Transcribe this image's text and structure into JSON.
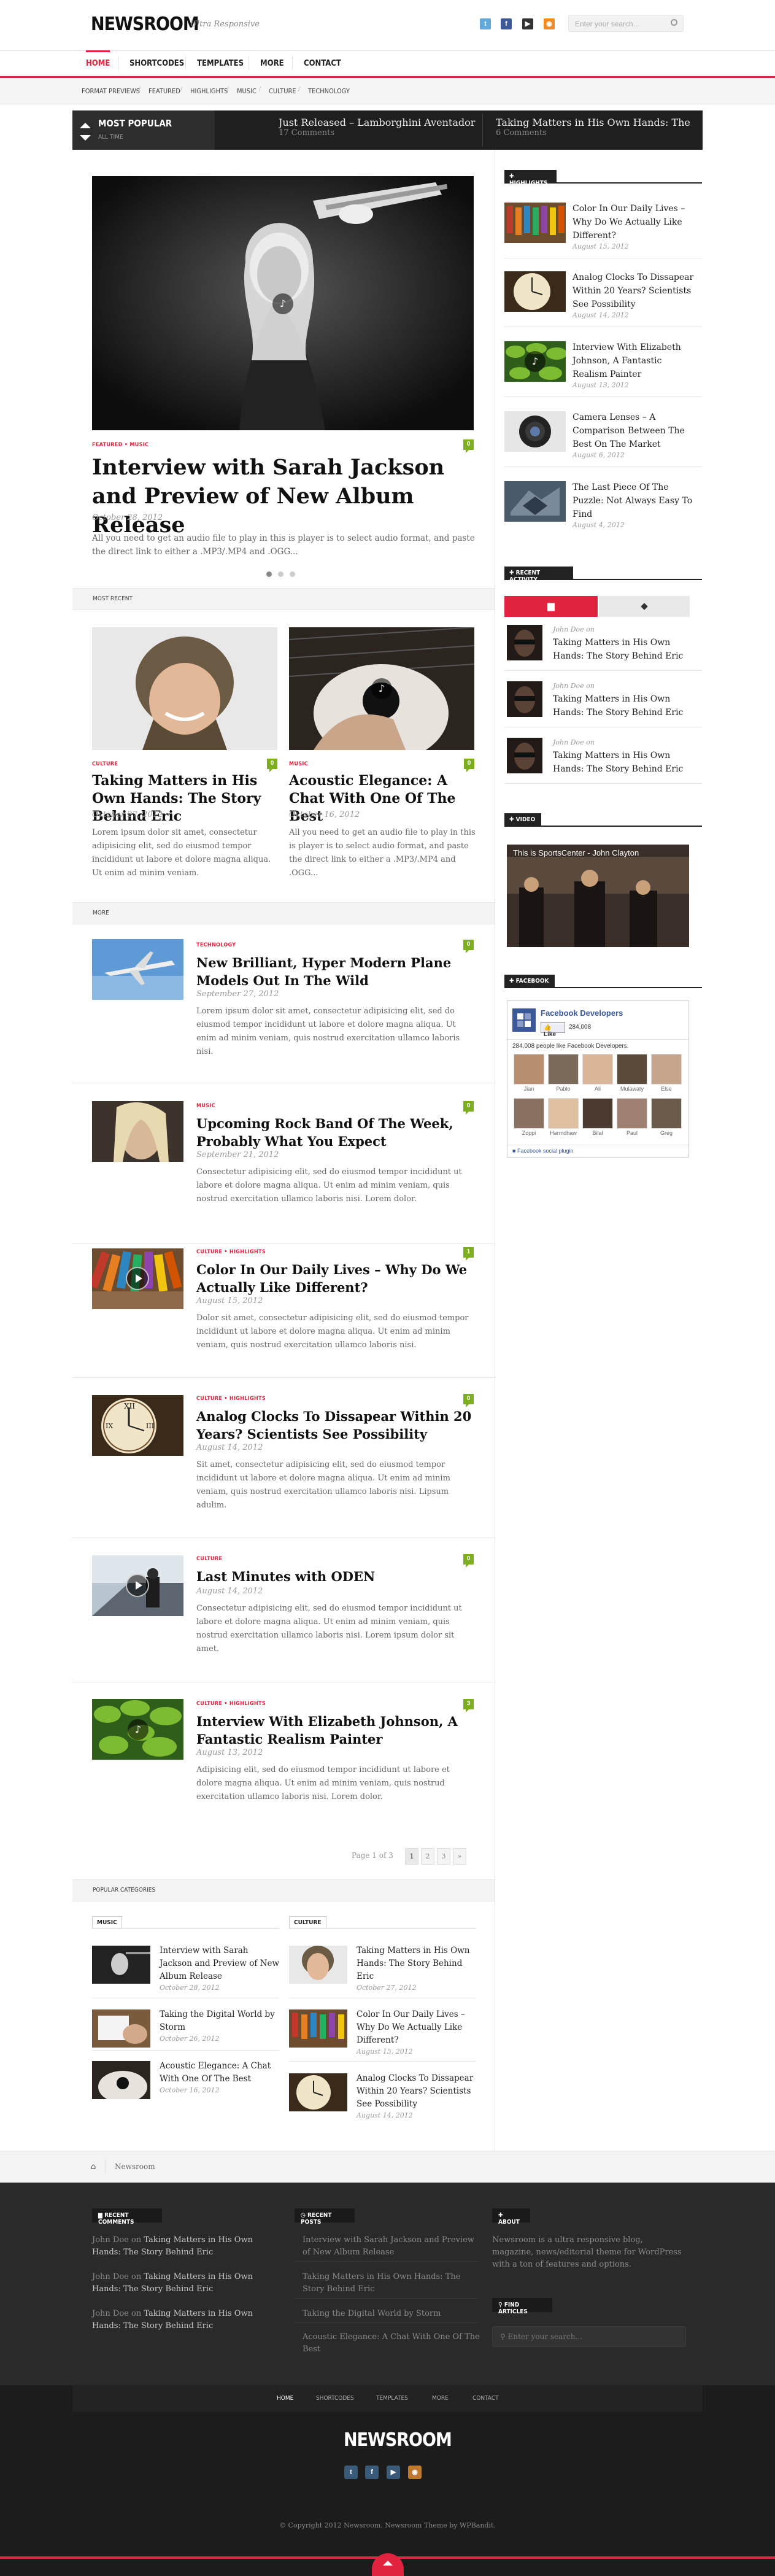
{
  "site": {
    "logo": "NEWSROOM",
    "tagline": "Ultra Responsive",
    "search_placeholder": "Enter your search..."
  },
  "nav": {
    "items": [
      "HOME",
      "SHORTCODES",
      "TEMPLATES",
      "MORE",
      "CONTACT"
    ]
  },
  "subnav": {
    "items": [
      "FORMAT PREVIEWS",
      "FEATURED",
      "HIGHLIGHTS",
      "MUSIC",
      "CULTURE",
      "TECHNOLOGY"
    ]
  },
  "popular_bar": {
    "title": "MOST POPULAR",
    "sub": "ALL TIME",
    "items": [
      {
        "title": "Just Released – Lamborghini Aventador",
        "meta": "17 Comments"
      },
      {
        "title": "Taking Matters in His Own Hands: The",
        "meta": "6 Comments"
      }
    ]
  },
  "featured": {
    "category": "FEATURED • MUSIC",
    "comments": "0",
    "title": "Interview with Sarah Jackson and Preview of New Album Release",
    "date": "October 28, 2012",
    "excerpt": "All you need to get an audio file to play in this is player is to select audio format, and paste the direct link to either a .MP3/.MP4 and .OGG..."
  },
  "most_recent": {
    "label": "MOST RECENT",
    "posts": [
      {
        "category": "CULTURE",
        "comments": "0",
        "title": "Taking Matters in His Own Hands: The Story Behind Eric",
        "date": "October 27, 2012",
        "excerpt": "Lorem ipsum dolor sit amet, consectetur adipisicing elit, sed do eiusmod tempor incididunt ut labore et dolore magna aliqua. Ut enim ad minim veniam."
      },
      {
        "category": "MUSIC",
        "comments": "0",
        "title": "Acoustic Elegance: A Chat With One Of The Best",
        "date": "October 16, 2012",
        "excerpt": "All you need to get an audio file to play in this is player is to select audio format, and paste the direct link to either a .MP3/.MP4 and .OGG..."
      }
    ]
  },
  "more": {
    "label": "MORE",
    "posts": [
      {
        "category": "TECHNOLOGY",
        "comments": "0",
        "title": "New Brilliant, Hyper Modern Plane Models Out In The Wild",
        "date": "September 27, 2012",
        "excerpt": "Lorem ipsum dolor sit amet, consectetur adipisicing elit, sed do eiusmod tempor incididunt ut labore et dolore magna aliqua. Ut enim ad minim veniam, quis nostrud exercitation ullamco laboris nisi."
      },
      {
        "category": "MUSIC",
        "comments": "0",
        "title": "Upcoming Rock Band Of The Week, Probably What You Expect",
        "date": "September 21, 2012",
        "excerpt": "Consectetur adipisicing elit, sed do eiusmod tempor incididunt ut labore et dolore magna aliqua. Ut enim ad minim veniam, quis nostrud exercitation ullamco laboris nisi. Lorem dolor."
      },
      {
        "category": "CULTURE • HIGHLIGHTS",
        "comments": "1",
        "title": "Color In Our Daily Lives – Why Do We Actually Like Different?",
        "date": "August 15, 2012",
        "excerpt": "Dolor sit amet, consectetur adipisicing elit, sed do eiusmod tempor incididunt ut labore et dolore magna aliqua. Ut enim ad minim veniam, quis nostrud exercitation ullamco laboris nisi."
      },
      {
        "category": "CULTURE • HIGHLIGHTS",
        "comments": "0",
        "title": "Analog Clocks To Dissapear Within 20 Years? Scientists See Possibility",
        "date": "August 14, 2012",
        "excerpt": "Sit amet, consectetur adipisicing elit, sed do eiusmod tempor incididunt ut labore et dolore magna aliqua. Ut enim ad minim veniam, quis nostrud exercitation ullamco laboris nisi. Lipsum adulim."
      },
      {
        "category": "CULTURE",
        "comments": "0",
        "title": "Last Minutes with ODEN",
        "date": "August 14, 2012",
        "excerpt": "Consectetur adipisicing elit, sed do eiusmod tempor incididunt ut labore et dolore magna aliqua. Ut enim ad minim veniam, quis nostrud exercitation ullamco laboris nisi. Lorem ipsum dolor sit amet."
      },
      {
        "category": "CULTURE • HIGHLIGHTS",
        "comments": "3",
        "title": "Interview With Elizabeth Johnson, A Fantastic Realism Painter",
        "date": "August 13, 2012",
        "excerpt": "Adipisicing elit, sed do eiusmod tempor incididunt ut labore et dolore magna aliqua. Ut enim ad minim veniam, quis nostrud exercitation ullamco laboris nisi. Lorem dolor."
      }
    ]
  },
  "pagination": {
    "label": "Page 1 of 3",
    "pages": [
      "1",
      "2",
      "3",
      "»"
    ]
  },
  "popular_categories": {
    "label": "POPULAR CATEGORIES",
    "music": {
      "label": "MUSIC",
      "items": [
        {
          "title": "Interview with Sarah Jackson and Preview of New Album Release",
          "date": "October 28, 2012"
        },
        {
          "title": "Taking the Digital World by Storm",
          "date": "October 26, 2012"
        },
        {
          "title": "Acoustic Elegance: A Chat With One Of The Best",
          "date": "October 16, 2012"
        }
      ]
    },
    "culture": {
      "label": "CULTURE",
      "items": [
        {
          "title": "Taking Matters in His Own Hands: The Story Behind Eric",
          "date": "October 27, 2012"
        },
        {
          "title": "Color In Our Daily Lives – Why Do We Actually Like Different?",
          "date": "August 15, 2012"
        },
        {
          "title": "Analog Clocks To Dissapear Within 20 Years? Scientists See Possibility",
          "date": "August 14, 2012"
        }
      ]
    }
  },
  "sidebar": {
    "highlights": {
      "label": "HIGHLIGHTS",
      "items": [
        {
          "title": "Color In Our Daily Lives – Why Do We Actually Like Different?",
          "date": "August 15, 2012"
        },
        {
          "title": "Analog Clocks To Dissapear Within 20 Years? Scientists See Possibility",
          "date": "August 14, 2012"
        },
        {
          "title": "Interview With Elizabeth Johnson, A Fantastic Realism Painter",
          "date": "August 13, 2012"
        },
        {
          "title": "Camera Lenses – A Comparison Between The Best On The Market",
          "date": "August 6, 2012"
        },
        {
          "title": "The Last Piece Of The Puzzle: Not Always Easy To Find",
          "date": "August 4, 2012"
        }
      ]
    },
    "activity": {
      "label": "RECENT ACTIVITY",
      "items": [
        {
          "author": "John Doe on",
          "title": "Taking Matters in His Own Hands: The Story Behind Eric"
        },
        {
          "author": "John Doe on",
          "title": "Taking Matters in His Own Hands: The Story Behind Eric"
        },
        {
          "author": "John Doe on",
          "title": "Taking Matters in His Own Hands: The Story Behind Eric"
        }
      ]
    },
    "video": {
      "label": "VIDEO",
      "caption": "This is SportsCenter - John Clayton"
    },
    "facebook": {
      "label": "FACEBOOK",
      "page_name": "Facebook Developers",
      "like": "Like",
      "count": "284,008",
      "people_text": "284,008 people like Facebook Developers.",
      "people": [
        "Jian",
        "Pablo",
        "Ali",
        "Mulawaty",
        "Else",
        "Zoppi",
        "Harmdhaw",
        "Bilal",
        "Paul",
        "Greg"
      ],
      "plugin": "Facebook social plugin"
    }
  },
  "breadcrumb": {
    "current": "Newsroom"
  },
  "footer": {
    "recent_comments": {
      "label": "RECENT COMMENTS",
      "items": [
        {
          "author": "John Doe on",
          "title": "Taking Matters in His Own Hands: The Story Behind Eric"
        },
        {
          "author": "John Doe on",
          "title": "Taking Matters in His Own Hands: The Story Behind Eric"
        },
        {
          "author": "John Doe on",
          "title": "Taking Matters in His Own Hands: The Story Behind Eric"
        }
      ]
    },
    "recent_posts": {
      "label": "RECENT POSTS",
      "items": [
        "Interview with Sarah Jackson and Preview of New Album Release",
        "Taking Matters in His Own Hands: The Story Behind Eric",
        "Taking the Digital World by Storm",
        "Acoustic Elegance: A Chat With One Of The Best"
      ]
    },
    "about": {
      "label": "ABOUT",
      "text": "Newsroom is a ultra responsive blog, magazine, news/editorial theme for WordPress with a ton of features and options."
    },
    "find": {
      "label": "FIND ARTICLES",
      "placeholder": "Enter your search..."
    },
    "bottom_nav": [
      "HOME",
      "SHORTCODES",
      "TEMPLATES",
      "MORE",
      "CONTACT"
    ],
    "logo": "NEWSROOM",
    "copyright": "© Copyright 2012 Newsroom. Newsroom Theme by WPBandit."
  },
  "colors": {
    "accent": "#e0233e",
    "badge": "#7cae1e",
    "dark": "#222222"
  }
}
